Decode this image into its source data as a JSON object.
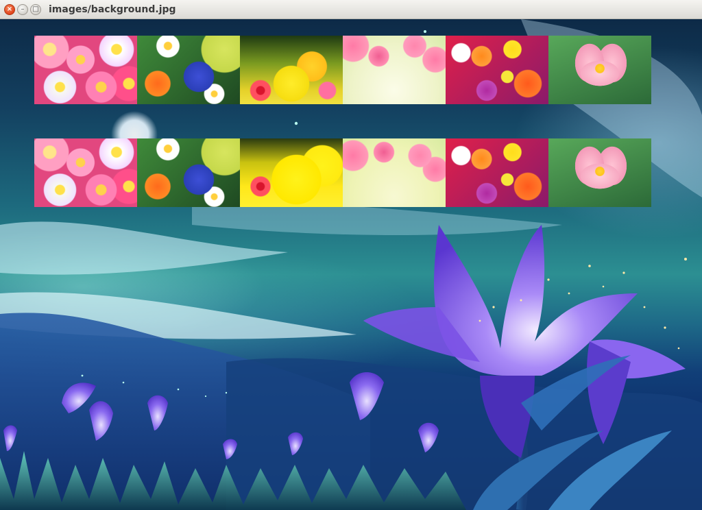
{
  "window": {
    "title": "images/background.jpg",
    "close_glyph": "×",
    "minimize_glyph": "–",
    "maximize_glyph": "□"
  },
  "thumbnails": {
    "row_1": [
      {
        "icon": "pink-flowers-thumbnail"
      },
      {
        "icon": "daisy-bouquet-thumbnail"
      },
      {
        "icon": "wildflower-meadow-thumbnail"
      },
      {
        "icon": "cherry-blossom-thumbnail"
      },
      {
        "icon": "gerbera-mix-thumbnail"
      },
      {
        "icon": "lotus-thumbnail"
      }
    ],
    "row_2": [
      {
        "icon": "pink-flowers-thumbnail"
      },
      {
        "icon": "daisy-bouquet-thumbnail"
      },
      {
        "icon": "wildflower-meadow-thumbnail"
      },
      {
        "icon": "cherry-blossom-thumbnail"
      },
      {
        "icon": "gerbera-mix-thumbnail"
      },
      {
        "icon": "lotus-thumbnail"
      }
    ]
  },
  "colors": {
    "title_bar": "#dcdad5",
    "close_button": "#e0431c",
    "sky_top": "#0d2a47",
    "sky_glow": "#2c8f92",
    "flower_purple": "#7b52e6"
  }
}
